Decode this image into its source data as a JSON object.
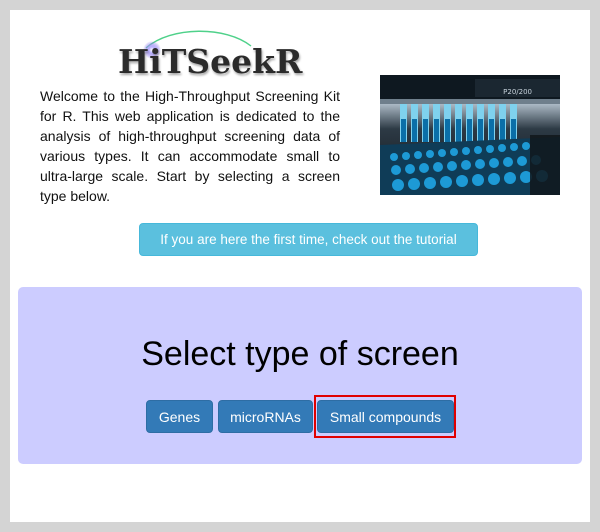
{
  "header": {
    "logo_text": "HiTSeekR"
  },
  "intro": {
    "text": "Welcome to the High-Throughput Screening Kit for R. This web application is dedicated to the analysis of high-throughput screening data of various types. It can accommodate small to ultra-large scale. Start by selecting a screen type below."
  },
  "photo": {
    "label": "P20/200"
  },
  "tutorial": {
    "label": "If you are here the first time, check out the tutorial"
  },
  "screen_select": {
    "title": "Select type of screen",
    "buttons": [
      {
        "label": "Genes"
      },
      {
        "label": "microRNAs"
      },
      {
        "label": "Small compounds"
      }
    ],
    "highlighted_index": 2
  },
  "colors": {
    "page_background": "#ffffff",
    "frame": "#d4d4d4",
    "panel_background": "#ccccff",
    "info_button": "#5bc0de",
    "primary_button": "#337ab7",
    "highlight_box": "#e00000"
  }
}
